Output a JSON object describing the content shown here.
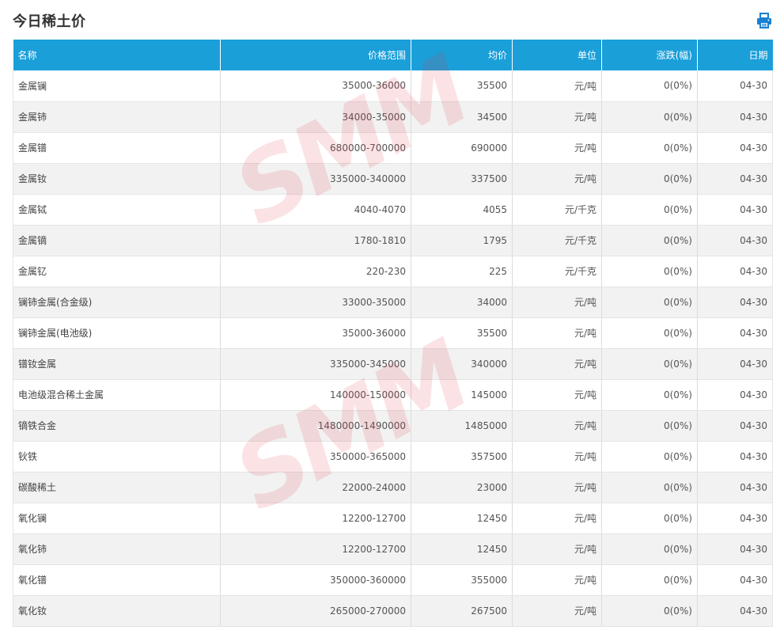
{
  "header": {
    "title": "今日稀土价",
    "print_icon": "printer-icon"
  },
  "colors": {
    "header_bg": "#1a9fd9",
    "print_icon": "#1a7fd0",
    "row_alt": "#f2f2f2",
    "watermark": "#e13c46"
  },
  "watermark": "SMM",
  "table": {
    "columns": [
      "名称",
      "价格范围",
      "均价",
      "单位",
      "涨跌(幅)",
      "日期"
    ],
    "rows": [
      {
        "name": "金属镧",
        "range": "35000-36000",
        "avg": "35500",
        "unit": "元/吨",
        "change": "0(0%)",
        "date": "04-30"
      },
      {
        "name": "金属铈",
        "range": "34000-35000",
        "avg": "34500",
        "unit": "元/吨",
        "change": "0(0%)",
        "date": "04-30"
      },
      {
        "name": "金属镨",
        "range": "680000-700000",
        "avg": "690000",
        "unit": "元/吨",
        "change": "0(0%)",
        "date": "04-30"
      },
      {
        "name": "金属钕",
        "range": "335000-340000",
        "avg": "337500",
        "unit": "元/吨",
        "change": "0(0%)",
        "date": "04-30"
      },
      {
        "name": "金属铽",
        "range": "4040-4070",
        "avg": "4055",
        "unit": "元/千克",
        "change": "0(0%)",
        "date": "04-30"
      },
      {
        "name": "金属镝",
        "range": "1780-1810",
        "avg": "1795",
        "unit": "元/千克",
        "change": "0(0%)",
        "date": "04-30"
      },
      {
        "name": "金属钇",
        "range": "220-230",
        "avg": "225",
        "unit": "元/千克",
        "change": "0(0%)",
        "date": "04-30"
      },
      {
        "name": "镧铈金属(合金级)",
        "range": "33000-35000",
        "avg": "34000",
        "unit": "元/吨",
        "change": "0(0%)",
        "date": "04-30"
      },
      {
        "name": "镧铈金属(电池级)",
        "range": "35000-36000",
        "avg": "35500",
        "unit": "元/吨",
        "change": "0(0%)",
        "date": "04-30"
      },
      {
        "name": "镨钕金属",
        "range": "335000-345000",
        "avg": "340000",
        "unit": "元/吨",
        "change": "0(0%)",
        "date": "04-30"
      },
      {
        "name": "电池级混合稀土金属",
        "range": "140000-150000",
        "avg": "145000",
        "unit": "元/吨",
        "change": "0(0%)",
        "date": "04-30"
      },
      {
        "name": "镝铁合金",
        "range": "1480000-1490000",
        "avg": "1485000",
        "unit": "元/吨",
        "change": "0(0%)",
        "date": "04-30"
      },
      {
        "name": "钬铁",
        "range": "350000-365000",
        "avg": "357500",
        "unit": "元/吨",
        "change": "0(0%)",
        "date": "04-30"
      },
      {
        "name": "碳酸稀土",
        "range": "22000-24000",
        "avg": "23000",
        "unit": "元/吨",
        "change": "0(0%)",
        "date": "04-30"
      },
      {
        "name": "氧化镧",
        "range": "12200-12700",
        "avg": "12450",
        "unit": "元/吨",
        "change": "0(0%)",
        "date": "04-30"
      },
      {
        "name": "氧化铈",
        "range": "12200-12700",
        "avg": "12450",
        "unit": "元/吨",
        "change": "0(0%)",
        "date": "04-30"
      },
      {
        "name": "氧化镨",
        "range": "350000-360000",
        "avg": "355000",
        "unit": "元/吨",
        "change": "0(0%)",
        "date": "04-30"
      },
      {
        "name": "氧化钕",
        "range": "265000-270000",
        "avg": "267500",
        "unit": "元/吨",
        "change": "0(0%)",
        "date": "04-30"
      }
    ]
  }
}
